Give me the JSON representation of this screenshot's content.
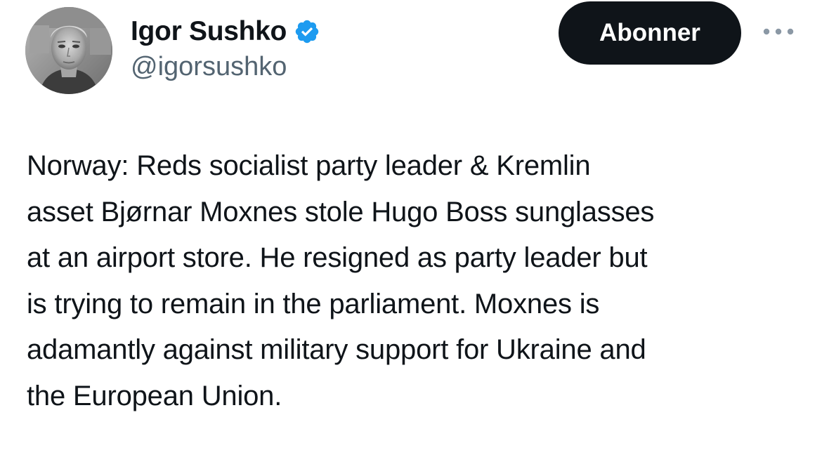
{
  "author": {
    "display_name": "Igor Sushko",
    "handle": "@igorsushko",
    "verified_icon": "verified-badge-icon",
    "avatar_icon": "profile-photo"
  },
  "header": {
    "follow_label": "Abonner",
    "more_icon": "more-options-icon"
  },
  "tweet": {
    "lines": [
      "Norway: Reds socialist party leader & Kremlin",
      "asset Bjørnar Moxnes stole Hugo Boss sunglasses",
      "at an airport store. He resigned as party leader but",
      "is trying to remain in the parliament. Moxnes is",
      "adamantly against military support for Ukraine and",
      "the European Union."
    ]
  },
  "colors": {
    "text": "#0f1419",
    "secondary_text": "#536471",
    "button_bg": "#0f1419",
    "button_text": "#ffffff",
    "verified_blue": "#1d9bf0",
    "background": "#ffffff"
  }
}
